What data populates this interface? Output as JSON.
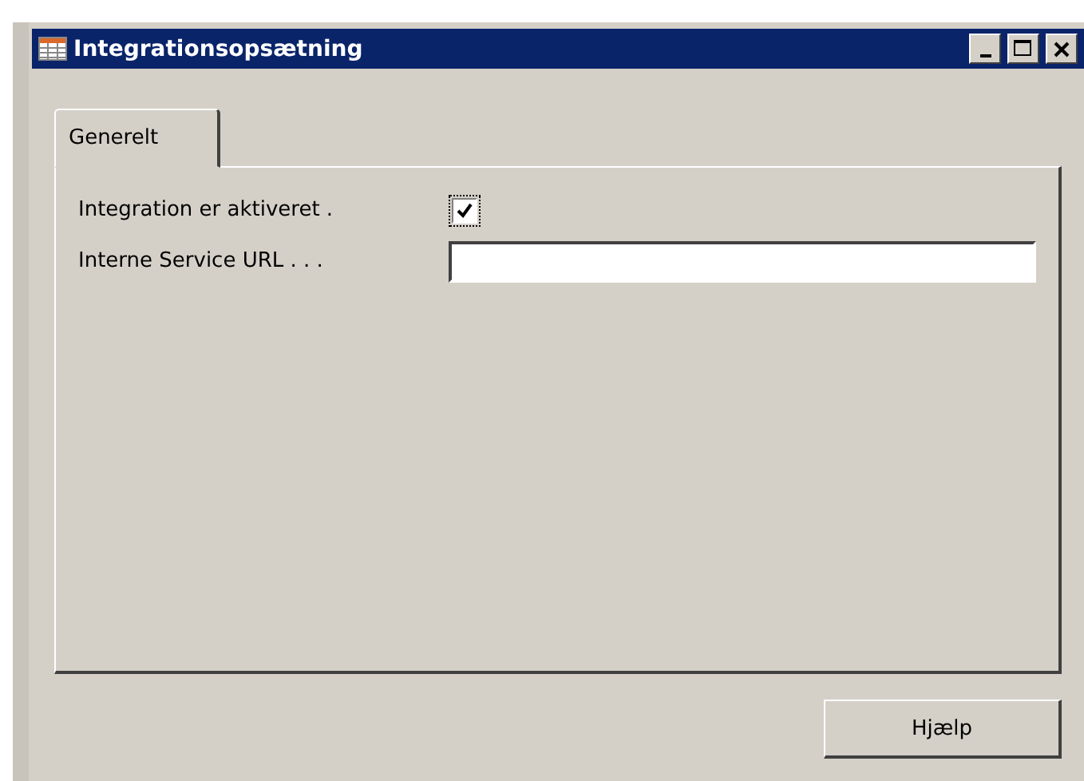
{
  "window": {
    "title": "Integrationsopsætning"
  },
  "tabs": [
    {
      "label": "Generelt",
      "selected": true
    }
  ],
  "fields": [
    {
      "kind": "checkbox",
      "label": "Integration er aktiveret .",
      "checked": true
    },
    {
      "kind": "text",
      "label": "Interne Service URL . . ."
    }
  ],
  "buttons": [
    "Hjælp"
  ]
}
